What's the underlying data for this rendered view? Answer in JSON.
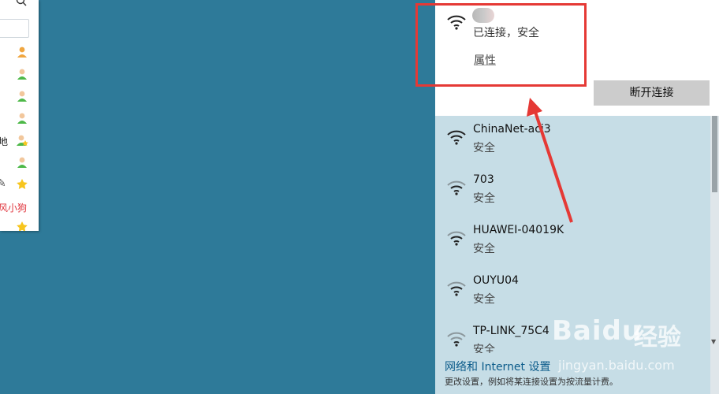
{
  "left_window": {
    "icons": [
      "search-icon"
    ],
    "rows": [
      {
        "text": "",
        "icon": "contact-orange-icon"
      },
      {
        "text": "",
        "icon": "contact-green-icon"
      },
      {
        "text": "",
        "icon": "contact-green-icon"
      },
      {
        "text": "",
        "icon": "contact-green-icon"
      },
      {
        "text": "地",
        "icon": "contact-star-icon"
      },
      {
        "text": "",
        "icon": "contact-green-icon"
      },
      {
        "text": "",
        "icon": "star-icon"
      },
      {
        "text": "风小狗",
        "icon": ""
      },
      {
        "text": "",
        "icon": "star-icon"
      }
    ]
  },
  "flyout": {
    "connected": {
      "status": "已连接，安全",
      "properties": "属性",
      "disconnect": "断开连接"
    },
    "networks": [
      {
        "ssid": "ChinaNet-aci3",
        "security": "安全"
      },
      {
        "ssid": "703",
        "security": "安全"
      },
      {
        "ssid": "HUAWEI-04019K",
        "security": "安全"
      },
      {
        "ssid": "OUYU04",
        "security": "安全"
      },
      {
        "ssid": "TP-LINK_75C4",
        "security": "安全"
      }
    ],
    "settings": {
      "link": "网络和 Internet 设置",
      "desc": "更改设置，例如将某连接设置为按流量计费。"
    }
  },
  "watermark": {
    "brand": "Baidu",
    "cn": "经验",
    "url": "jingyan.baidu.com"
  },
  "colors": {
    "desktop": "#2e7a99",
    "list_bg": "#c6dde6",
    "annotation": "#e53935"
  }
}
